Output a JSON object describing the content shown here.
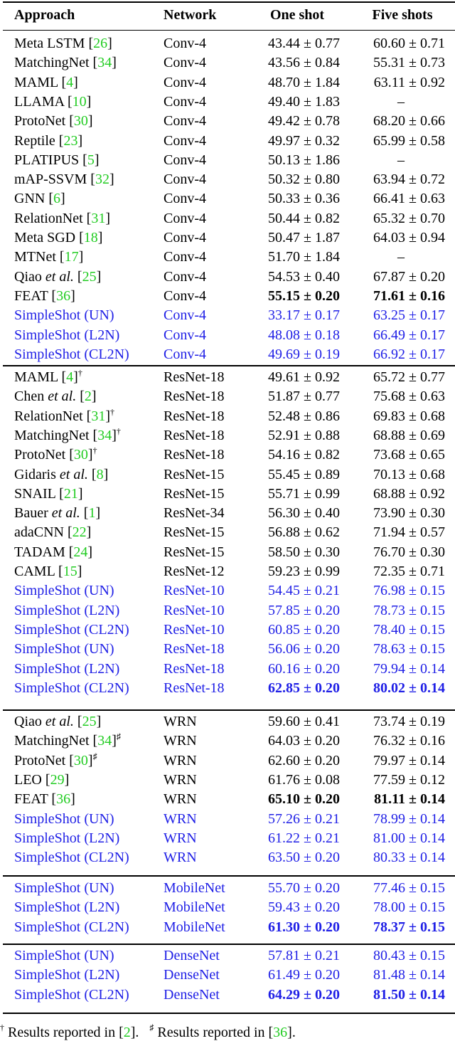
{
  "table": {
    "headers": [
      "Approach",
      "Network",
      "One shot",
      "Five shots"
    ],
    "sections": [
      {
        "rows": [
          {
            "approach": "Meta LSTM",
            "cite": "26",
            "mark": "",
            "italic": "",
            "network": "Conv-4",
            "one_shot": "43.44 ± 0.77",
            "five_shots": "60.60 ± 0.71",
            "ours": false,
            "best1": false,
            "best5": false
          },
          {
            "approach": "MatchingNet",
            "cite": "34",
            "mark": "",
            "italic": "",
            "network": "Conv-4",
            "one_shot": "43.56 ± 0.84",
            "five_shots": "55.31 ± 0.73",
            "ours": false,
            "best1": false,
            "best5": false
          },
          {
            "approach": "MAML",
            "cite": "4",
            "mark": "",
            "italic": "",
            "network": "Conv-4",
            "one_shot": "48.70 ± 1.84",
            "five_shots": "63.11 ± 0.92",
            "ours": false,
            "best1": false,
            "best5": false
          },
          {
            "approach": "LLAMA",
            "cite": "10",
            "mark": "",
            "italic": "",
            "network": "Conv-4",
            "one_shot": "49.40 ± 1.83",
            "five_shots": "–",
            "ours": false,
            "best1": false,
            "best5": false
          },
          {
            "approach": "ProtoNet",
            "cite": "30",
            "mark": "",
            "italic": "",
            "network": "Conv-4",
            "one_shot": "49.42 ± 0.78",
            "five_shots": "68.20 ± 0.66",
            "ours": false,
            "best1": false,
            "best5": false
          },
          {
            "approach": "Reptile",
            "cite": "23",
            "mark": "",
            "italic": "",
            "network": "Conv-4",
            "one_shot": "49.97 ± 0.32",
            "five_shots": "65.99 ± 0.58",
            "ours": false,
            "best1": false,
            "best5": false
          },
          {
            "approach": "PLATIPUS",
            "cite": "5",
            "mark": "",
            "italic": "",
            "network": "Conv-4",
            "one_shot": "50.13 ± 1.86",
            "five_shots": "–",
            "ours": false,
            "best1": false,
            "best5": false
          },
          {
            "approach": "mAP-SSVM",
            "cite": "32",
            "mark": "",
            "italic": "",
            "network": "Conv-4",
            "one_shot": "50.32 ± 0.80",
            "five_shots": "63.94 ± 0.72",
            "ours": false,
            "best1": false,
            "best5": false
          },
          {
            "approach": "GNN",
            "cite": "6",
            "mark": "",
            "italic": "",
            "network": "Conv-4",
            "one_shot": "50.33 ± 0.36",
            "five_shots": "66.41 ± 0.63",
            "ours": false,
            "best1": false,
            "best5": false
          },
          {
            "approach": "RelationNet",
            "cite": "31",
            "mark": "",
            "italic": "",
            "network": "Conv-4",
            "one_shot": "50.44 ± 0.82",
            "five_shots": "65.32 ± 0.70",
            "ours": false,
            "best1": false,
            "best5": false
          },
          {
            "approach": "Meta SGD",
            "cite": "18",
            "mark": "",
            "italic": "",
            "network": "Conv-4",
            "one_shot": "50.47 ± 1.87",
            "five_shots": "64.03 ± 0.94",
            "ours": false,
            "best1": false,
            "best5": false
          },
          {
            "approach": "MTNet",
            "cite": "17",
            "mark": "",
            "italic": "",
            "network": "Conv-4",
            "one_shot": "51.70 ± 1.84",
            "five_shots": "–",
            "ours": false,
            "best1": false,
            "best5": false
          },
          {
            "approach": "Qiao ",
            "cite": "25",
            "mark": "",
            "italic": "et al.",
            "network": "Conv-4",
            "one_shot": "54.53 ± 0.40",
            "five_shots": "67.87 ± 0.20",
            "ours": false,
            "best1": false,
            "best5": false
          },
          {
            "approach": "FEAT",
            "cite": "36",
            "mark": "",
            "italic": "",
            "network": "Conv-4",
            "one_shot": "55.15 ± 0.20",
            "five_shots": "71.61 ± 0.16",
            "ours": false,
            "best1": true,
            "best5": true
          },
          {
            "approach": "SimpleShot (UN)",
            "cite": "",
            "mark": "",
            "italic": "",
            "network": "Conv-4",
            "one_shot": "33.17 ± 0.17",
            "five_shots": "63.25 ± 0.17",
            "ours": true,
            "best1": false,
            "best5": false
          },
          {
            "approach": "SimpleShot (L2N)",
            "cite": "",
            "mark": "",
            "italic": "",
            "network": "Conv-4",
            "one_shot": "48.08 ± 0.18",
            "five_shots": "66.49 ± 0.17",
            "ours": true,
            "best1": false,
            "best5": false
          },
          {
            "approach": "SimpleShot (CL2N)",
            "cite": "",
            "mark": "",
            "italic": "",
            "network": "Conv-4",
            "one_shot": "49.69 ± 0.19",
            "five_shots": "66.92 ± 0.17",
            "ours": true,
            "best1": false,
            "best5": false
          }
        ]
      },
      {
        "rows": [
          {
            "approach": "MAML",
            "cite": "4",
            "mark": "†",
            "italic": "",
            "network": "ResNet-18",
            "one_shot": "49.61 ± 0.92",
            "five_shots": "65.72 ± 0.77",
            "ours": false,
            "best1": false,
            "best5": false
          },
          {
            "approach": "Chen ",
            "cite": "2",
            "mark": "",
            "italic": "et al.",
            "network": "ResNet-18",
            "one_shot": "51.87 ± 0.77",
            "five_shots": "75.68 ± 0.63",
            "ours": false,
            "best1": false,
            "best5": false
          },
          {
            "approach": "RelationNet",
            "cite": "31",
            "mark": "†",
            "italic": "",
            "network": "ResNet-18",
            "one_shot": "52.48 ± 0.86",
            "five_shots": "69.83 ± 0.68",
            "ours": false,
            "best1": false,
            "best5": false
          },
          {
            "approach": "MatchingNet",
            "cite": "34",
            "mark": "†",
            "italic": "",
            "network": "ResNet-18",
            "one_shot": "52.91 ± 0.88",
            "five_shots": "68.88 ± 0.69",
            "ours": false,
            "best1": false,
            "best5": false
          },
          {
            "approach": "ProtoNet",
            "cite": "30",
            "mark": "†",
            "italic": "",
            "network": "ResNet-18",
            "one_shot": "54.16 ± 0.82",
            "five_shots": "73.68 ± 0.65",
            "ours": false,
            "best1": false,
            "best5": false
          },
          {
            "approach": "Gidaris ",
            "cite": "8",
            "mark": "",
            "italic": "et al.",
            "network": "ResNet-15",
            "one_shot": "55.45 ± 0.89",
            "five_shots": "70.13 ± 0.68",
            "ours": false,
            "best1": false,
            "best5": false
          },
          {
            "approach": "SNAIL",
            "cite": "21",
            "mark": "",
            "italic": "",
            "network": "ResNet-15",
            "one_shot": "55.71 ± 0.99",
            "five_shots": "68.88 ± 0.92",
            "ours": false,
            "best1": false,
            "best5": false
          },
          {
            "approach": "Bauer ",
            "cite": "1",
            "mark": "",
            "italic": "et al.",
            "network": "ResNet-34",
            "one_shot": "56.30 ± 0.40",
            "five_shots": "73.90 ± 0.30",
            "ours": false,
            "best1": false,
            "best5": false
          },
          {
            "approach": "adaCNN",
            "cite": "22",
            "mark": "",
            "italic": "",
            "network": "ResNet-15",
            "one_shot": "56.88 ± 0.62",
            "five_shots": "71.94 ± 0.57",
            "ours": false,
            "best1": false,
            "best5": false
          },
          {
            "approach": "TADAM",
            "cite": "24",
            "mark": "",
            "italic": "",
            "network": "ResNet-15",
            "one_shot": "58.50 ± 0.30",
            "five_shots": "76.70 ± 0.30",
            "ours": false,
            "best1": false,
            "best5": false
          },
          {
            "approach": "CAML",
            "cite": "15",
            "mark": "",
            "italic": "",
            "network": "ResNet-12",
            "one_shot": "59.23 ± 0.99",
            "five_shots": "72.35 ± 0.71",
            "ours": false,
            "best1": false,
            "best5": false
          },
          {
            "approach": "SimpleShot (UN)",
            "cite": "",
            "mark": "",
            "italic": "",
            "network": "ResNet-10",
            "one_shot": "54.45 ± 0.21",
            "five_shots": "76.98 ± 0.15",
            "ours": true,
            "best1": false,
            "best5": false
          },
          {
            "approach": "SimpleShot (L2N)",
            "cite": "",
            "mark": "",
            "italic": "",
            "network": "ResNet-10",
            "one_shot": "57.85 ± 0.20",
            "five_shots": "78.73 ± 0.15",
            "ours": true,
            "best1": false,
            "best5": false
          },
          {
            "approach": "SimpleShot (CL2N)",
            "cite": "",
            "mark": "",
            "italic": "",
            "network": "ResNet-10",
            "one_shot": "60.85 ± 0.20",
            "five_shots": "78.40 ± 0.15",
            "ours": true,
            "best1": false,
            "best5": false
          },
          {
            "approach": "SimpleShot (UN)",
            "cite": "",
            "mark": "",
            "italic": "",
            "network": "ResNet-18",
            "one_shot": "56.06 ± 0.20",
            "five_shots": "78.63 ± 0.15",
            "ours": true,
            "best1": false,
            "best5": false
          },
          {
            "approach": "SimpleShot (L2N)",
            "cite": "",
            "mark": "",
            "italic": "",
            "network": "ResNet-18",
            "one_shot": "60.16 ± 0.20",
            "five_shots": "79.94 ± 0.14",
            "ours": true,
            "best1": false,
            "best5": false
          },
          {
            "approach": "SimpleShot (CL2N)",
            "cite": "",
            "mark": "",
            "italic": "",
            "network": "ResNet-18",
            "one_shot": "62.85 ± 0.20",
            "five_shots": "80.02 ± 0.14",
            "ours": true,
            "best1": true,
            "best5": true
          }
        ]
      },
      {
        "rows": [
          {
            "approach": "Qiao ",
            "cite": "25",
            "mark": "",
            "italic": "et al.",
            "network": "WRN",
            "one_shot": "59.60 ± 0.41",
            "five_shots": "73.74 ± 0.19",
            "ours": false,
            "best1": false,
            "best5": false
          },
          {
            "approach": "MatchingNet",
            "cite": "34",
            "mark": "♯",
            "italic": "",
            "network": "WRN",
            "one_shot": "64.03 ± 0.20",
            "five_shots": "76.32 ± 0.16",
            "ours": false,
            "best1": false,
            "best5": false
          },
          {
            "approach": "ProtoNet",
            "cite": "30",
            "mark": "♯",
            "italic": "",
            "network": "WRN",
            "one_shot": "62.60 ± 0.20",
            "five_shots": "79.97 ± 0.14",
            "ours": false,
            "best1": false,
            "best5": false
          },
          {
            "approach": "LEO",
            "cite": "29",
            "mark": "",
            "italic": "",
            "network": "WRN",
            "one_shot": "61.76 ± 0.08",
            "five_shots": "77.59 ± 0.12",
            "ours": false,
            "best1": false,
            "best5": false
          },
          {
            "approach": "FEAT",
            "cite": "36",
            "mark": "",
            "italic": "",
            "network": "WRN",
            "one_shot": "65.10 ± 0.20",
            "five_shots": "81.11 ± 0.14",
            "ours": false,
            "best1": true,
            "best5": true
          },
          {
            "approach": "SimpleShot (UN)",
            "cite": "",
            "mark": "",
            "italic": "",
            "network": "WRN",
            "one_shot": "57.26 ± 0.21",
            "five_shots": "78.99 ± 0.14",
            "ours": true,
            "best1": false,
            "best5": false
          },
          {
            "approach": "SimpleShot (L2N)",
            "cite": "",
            "mark": "",
            "italic": "",
            "network": "WRN",
            "one_shot": "61.22 ± 0.21",
            "five_shots": "81.00 ± 0.14",
            "ours": true,
            "best1": false,
            "best5": false
          },
          {
            "approach": "SimpleShot (CL2N)",
            "cite": "",
            "mark": "",
            "italic": "",
            "network": "WRN",
            "one_shot": "63.50 ± 0.20",
            "five_shots": "80.33 ± 0.14",
            "ours": true,
            "best1": false,
            "best5": false
          }
        ]
      },
      {
        "rows": [
          {
            "approach": "SimpleShot (UN)",
            "cite": "",
            "mark": "",
            "italic": "",
            "network": "MobileNet",
            "one_shot": "55.70 ± 0.20",
            "five_shots": "77.46 ± 0.15",
            "ours": true,
            "best1": false,
            "best5": false
          },
          {
            "approach": "SimpleShot (L2N)",
            "cite": "",
            "mark": "",
            "italic": "",
            "network": "MobileNet",
            "one_shot": "59.43 ± 0.20",
            "five_shots": "78.00 ± 0.15",
            "ours": true,
            "best1": false,
            "best5": false
          },
          {
            "approach": "SimpleShot (CL2N)",
            "cite": "",
            "mark": "",
            "italic": "",
            "network": "MobileNet",
            "one_shot": "61.30 ± 0.20",
            "five_shots": "78.37 ± 0.15",
            "ours": true,
            "best1": true,
            "best5": true
          }
        ]
      },
      {
        "rows": [
          {
            "approach": "SimpleShot (UN)",
            "cite": "",
            "mark": "",
            "italic": "",
            "network": "DenseNet",
            "one_shot": "57.81 ± 0.21",
            "five_shots": "80.43 ± 0.15",
            "ours": true,
            "best1": false,
            "best5": false
          },
          {
            "approach": "SimpleShot (L2N)",
            "cite": "",
            "mark": "",
            "italic": "",
            "network": "DenseNet",
            "one_shot": "61.49 ± 0.20",
            "five_shots": "81.48 ± 0.14",
            "ours": true,
            "best1": false,
            "best5": false
          },
          {
            "approach": "SimpleShot (CL2N)",
            "cite": "",
            "mark": "",
            "italic": "",
            "network": "DenseNet",
            "one_shot": "64.29 ± 0.20",
            "five_shots": "81.50 ± 0.14",
            "ours": true,
            "best1": true,
            "best5": true
          }
        ]
      }
    ]
  },
  "footnote": {
    "dagger_mark": "†",
    "dagger_text": " Results reported in [",
    "dagger_cite": "2",
    "dagger_end": "].",
    "sharp_mark": "♯",
    "sharp_text": " Results reported in [",
    "sharp_cite": "36",
    "sharp_end": "]."
  },
  "colors": {
    "ours": "#1f1fe6",
    "citation": "#22cc22",
    "text": "#000000"
  }
}
